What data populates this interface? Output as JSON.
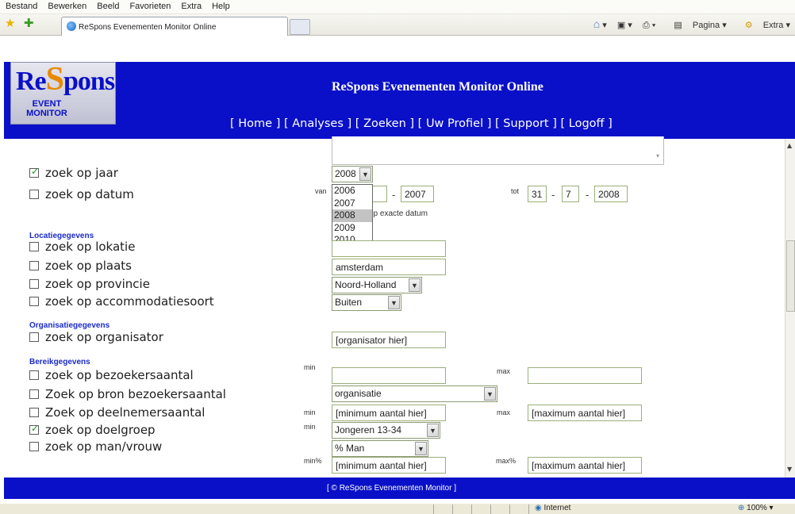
{
  "browser": {
    "menu": [
      "Bestand",
      "Bewerken",
      "Beeld",
      "Favorieten",
      "Extra",
      "Help"
    ],
    "tab_title": "ReSpons Evenementen Monitor Online",
    "commands": {
      "page": "Pagina",
      "extra": "Extra"
    },
    "status": {
      "zone": "Internet",
      "zoom": "100%"
    }
  },
  "header": {
    "logo_re": "Re",
    "logo_s": "S",
    "logo_pons": "pons",
    "logo_line1": "EVENT",
    "logo_line2": "MONITOR",
    "title": "ReSpons Evenementen Monitor Online",
    "nav": [
      "Home",
      "Analyses",
      "Zoeken",
      "Uw Profiel",
      "Support",
      "Logoff"
    ]
  },
  "form": {
    "jaar": {
      "label": "zoek op jaar",
      "checked": true,
      "value": "2008"
    },
    "year_options": [
      "2006",
      "2007",
      "2008",
      "2009",
      "2010"
    ],
    "selected_year": "2008",
    "datum": {
      "label": "zoek op datum",
      "checked": false,
      "van": "van",
      "tot": "tot",
      "from_year": "2007",
      "to_day": "31",
      "to_month": "7",
      "to_year": "2008",
      "exact_label": "op exacte datum"
    },
    "locatie": {
      "section": "Locatiegegevens",
      "lokatie_label": "zoek op lokatie",
      "lokatie_value": "",
      "plaats_label": "zoek op plaats",
      "plaats_value": "amsterdam",
      "provincie_label": "zoek op provincie",
      "provincie_value": "Noord-Holland",
      "accommodatie_label": "zoek op accommodatiesoort",
      "accommodatie_value": "Buiten"
    },
    "organisatie": {
      "section": "Organisatiegegevens",
      "label": "zoek op organisator",
      "value": "[organisator hier]"
    },
    "bereik": {
      "section": "Bereikgegevens",
      "bezoekers_label": "zoek op bezoekersaantal",
      "min": "min",
      "max": "max",
      "bron_label": "Zoek op bron bezoekersaantal",
      "bron_value": "organisatie",
      "deelnemers_label": "Zoek op deelnemersaantal",
      "min_placeholder": "[minimum aantal hier]",
      "max_placeholder": "[maximum aantal hier]",
      "doelgroep_label": "zoek op doelgroep",
      "doelgroep_value": "Jongeren 13-34",
      "manvrouw_label": "zoek op man/vrouw",
      "manvrouw_value": "% Man",
      "minpct": "min%",
      "maxpct": "max%"
    }
  },
  "footer": {
    "text": "[ © ReSpons Evenementen Monitor ]"
  }
}
